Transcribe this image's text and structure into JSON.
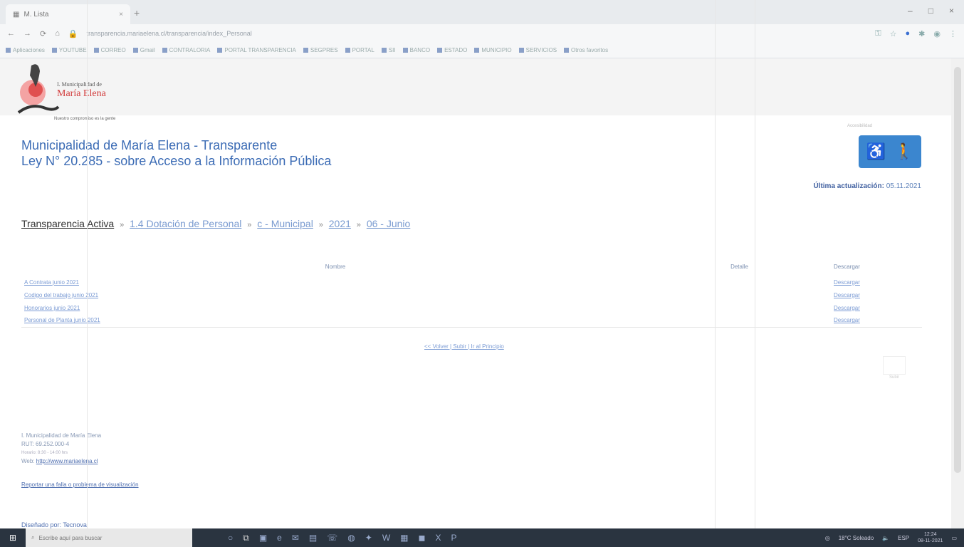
{
  "browser": {
    "tab_title": "M. Lista",
    "tab_close": "×",
    "new_tab": "+",
    "window_controls": [
      "–",
      "□",
      "×"
    ],
    "url": "transparencia.mariaelena.cl/transparencia/index_Personal",
    "bookmarks": [
      "Aplicaciones",
      "YOUTUBE",
      "CORREO",
      "Gmail",
      "CONTRALORIA",
      "PORTAL TRANSPARENCIA",
      "SEGPRES",
      "PORTAL",
      "SII",
      "BANCO",
      "ESTADO",
      "MUNICIPIO",
      "SERVICIOS",
      "Otros favoritos"
    ]
  },
  "header": {
    "logo_small": "I. Municipalidad de",
    "logo_big": "María Elena",
    "logo_slogan": "Nuestro compromiso es la gente",
    "title_line1": "Municipalidad de María Elena - Transparente",
    "title_line2": "Ley N° 20.285 - sobre Acceso a la Información Pública",
    "accessibility_label": "Accesibilidad",
    "last_update_label": "Última actualización:",
    "last_update_value": "05.11.2021"
  },
  "breadcrumb": {
    "root": "Transparencia Activa",
    "items": [
      "1.4 Dotación de Personal",
      "c - Municipal",
      "2021",
      "06 - Junio"
    ]
  },
  "table": {
    "headers": [
      "Nombre",
      "Detalle",
      "Descargar"
    ],
    "rows": [
      {
        "name": "A Contrata junio 2021",
        "detail": "",
        "download": "Descargar"
      },
      {
        "name": "Codigo del trabajo junio 2021",
        "detail": "",
        "download": "Descargar"
      },
      {
        "name": "Honorarios junio 2021",
        "detail": "",
        "download": "Descargar"
      },
      {
        "name": "Personal de Planta junio 2021",
        "detail": "",
        "download": "Descargar"
      }
    ]
  },
  "nav_links": "<< Volver | Subir | Ir al Principio",
  "back_to_top_label": "Subir",
  "footer": {
    "org": "I. Municipalidad de María Elena",
    "rut": "RUT: 69.252.000-4",
    "schedule": "Horario: 8:30 - 14:00 hrs",
    "web_label": "Web:",
    "web_link": "http://www.mariaelena.cl",
    "report_link": "Reportar una falla o problema de visualización",
    "bottom_text": "Diseñado por: Tecnova"
  },
  "taskbar": {
    "search_placeholder": "Escribe aquí para buscar",
    "weather": "18°C Soleado",
    "time": "12:24",
    "date": "08-11-2021",
    "lang": "ESP"
  }
}
